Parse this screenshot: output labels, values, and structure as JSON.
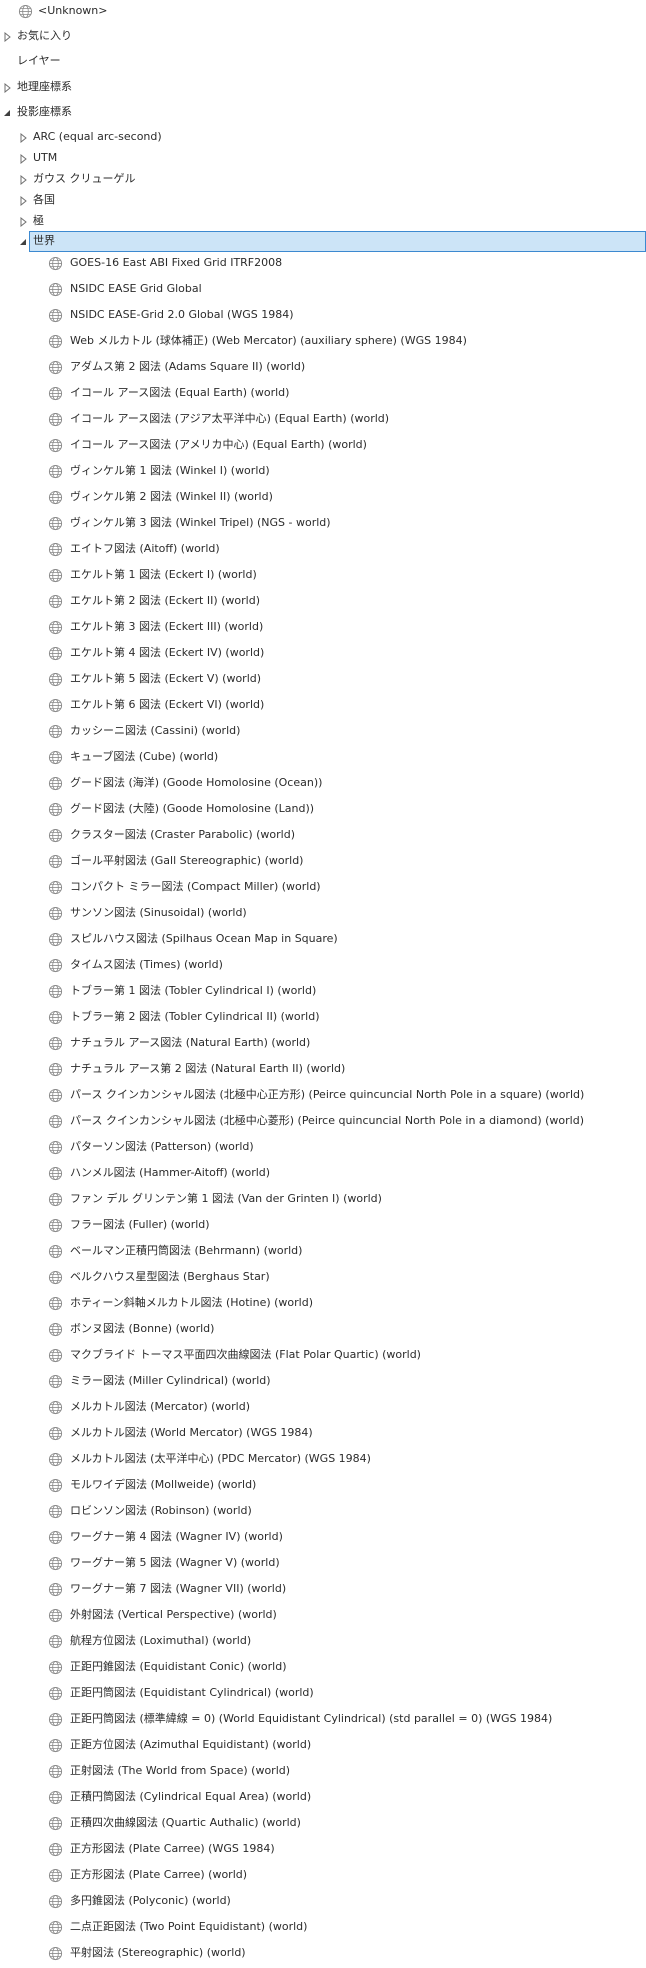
{
  "tree": {
    "unknown_label": "<Unknown>",
    "favorites": "お気に入り",
    "layers": "レイヤー",
    "geographic": "地理座標系",
    "projected": "投影座標系",
    "categories": [
      "ARC (equal arc-second)",
      "UTM",
      "ガウス クリューゲル",
      "各国",
      "極"
    ],
    "world": "世界",
    "items": [
      "GOES-16 East ABI Fixed Grid ITRF2008",
      "NSIDC EASE Grid Global",
      "NSIDC EASE-Grid 2.0 Global (WGS 1984)",
      "Web メルカトル (球体補正) (Web Mercator) (auxiliary sphere) (WGS 1984)",
      "アダムス第 2 図法 (Adams Square II) (world)",
      "イコール アース図法 (Equal Earth) (world)",
      "イコール アース図法 (アジア太平洋中心) (Equal Earth) (world)",
      "イコール アース図法 (アメリカ中心) (Equal Earth) (world)",
      "ヴィンケル第 1 図法 (Winkel I) (world)",
      "ヴィンケル第 2 図法 (Winkel II) (world)",
      "ヴィンケル第 3 図法 (Winkel Tripel) (NGS - world)",
      "エイトフ図法 (Aitoff) (world)",
      "エケルト第 1 図法 (Eckert I) (world)",
      "エケルト第 2 図法 (Eckert II) (world)",
      "エケルト第 3 図法 (Eckert III) (world)",
      "エケルト第 4 図法 (Eckert IV) (world)",
      "エケルト第 5 図法 (Eckert V) (world)",
      "エケルト第 6 図法 (Eckert VI) (world)",
      "カッシーニ図法 (Cassini) (world)",
      "キューブ図法 (Cube) (world)",
      "グード図法 (海洋) (Goode Homolosine (Ocean))",
      "グード図法 (大陸) (Goode Homolosine (Land))",
      "クラスター図法 (Craster Parabolic) (world)",
      "ゴール平射図法 (Gall Stereographic) (world)",
      "コンパクト ミラー図法 (Compact Miller) (world)",
      "サンソン図法 (Sinusoidal) (world)",
      "スピルハウス図法 (Spilhaus Ocean Map in Square)",
      "タイムス図法 (Times) (world)",
      "トブラー第 1 図法 (Tobler Cylindrical I) (world)",
      "トブラー第 2 図法 (Tobler Cylindrical II) (world)",
      "ナチュラル アース図法 (Natural Earth) (world)",
      "ナチュラル アース第 2 図法 (Natural Earth II) (world)",
      "パース クインカンシャル図法 (北極中心正方形) (Peirce quincuncial North Pole in a square) (world)",
      "パース クインカンシャル図法 (北極中心菱形) (Peirce quincuncial North Pole in a diamond) (world)",
      "パターソン図法 (Patterson) (world)",
      "ハンメル図法 (Hammer-Aitoff) (world)",
      "ファン デル グリンテン第 1 図法 (Van der Grinten I) (world)",
      "フラー図法 (Fuller) (world)",
      "ベールマン正積円筒図法 (Behrmann) (world)",
      "ベルクハウス星型図法 (Berghaus Star)",
      "ホティーン斜軸メルカトル図法 (Hotine) (world)",
      "ボンヌ図法 (Bonne) (world)",
      "マクブライド トーマス平面四次曲線図法 (Flat Polar Quartic) (world)",
      "ミラー図法 (Miller Cylindrical) (world)",
      "メルカトル図法 (Mercator) (world)",
      "メルカトル図法 (World Mercator) (WGS 1984)",
      "メルカトル図法 (太平洋中心) (PDC Mercator) (WGS 1984)",
      "モルワイデ図法 (Mollweide) (world)",
      "ロビンソン図法 (Robinson) (world)",
      "ワーグナー第 4 図法 (Wagner IV) (world)",
      "ワーグナー第 5 図法 (Wagner V) (world)",
      "ワーグナー第 7 図法 (Wagner VII) (world)",
      "外射図法 (Vertical Perspective) (world)",
      "航程方位図法 (Loximuthal) (world)",
      "正距円錐図法 (Equidistant Conic) (world)",
      "正距円筒図法 (Equidistant Cylindrical) (world)",
      "正距円筒図法 (標準緯線 = 0) (World Equidistant Cylindrical) (std parallel = 0) (WGS 1984)",
      "正距方位図法 (Azimuthal Equidistant) (world)",
      "正射図法 (The World from Space) (world)",
      "正積円筒図法 (Cylindrical Equal Area) (world)",
      "正積四次曲線図法 (Quartic Authalic) (world)",
      "正方形図法 (Plate Carree) (WGS 1984)",
      "正方形図法 (Plate Carree) (world)",
      "多円錐図法 (Polyconic) (world)",
      "二点正距図法 (Two Point Equidistant) (world)",
      "平射図法 (Stereographic) (world)"
    ]
  },
  "colors": {
    "selection_fill": "#cce4f7",
    "selection_border": "#3c89d0",
    "text": "#2b2b2b",
    "icon": "#8a8a8a"
  }
}
